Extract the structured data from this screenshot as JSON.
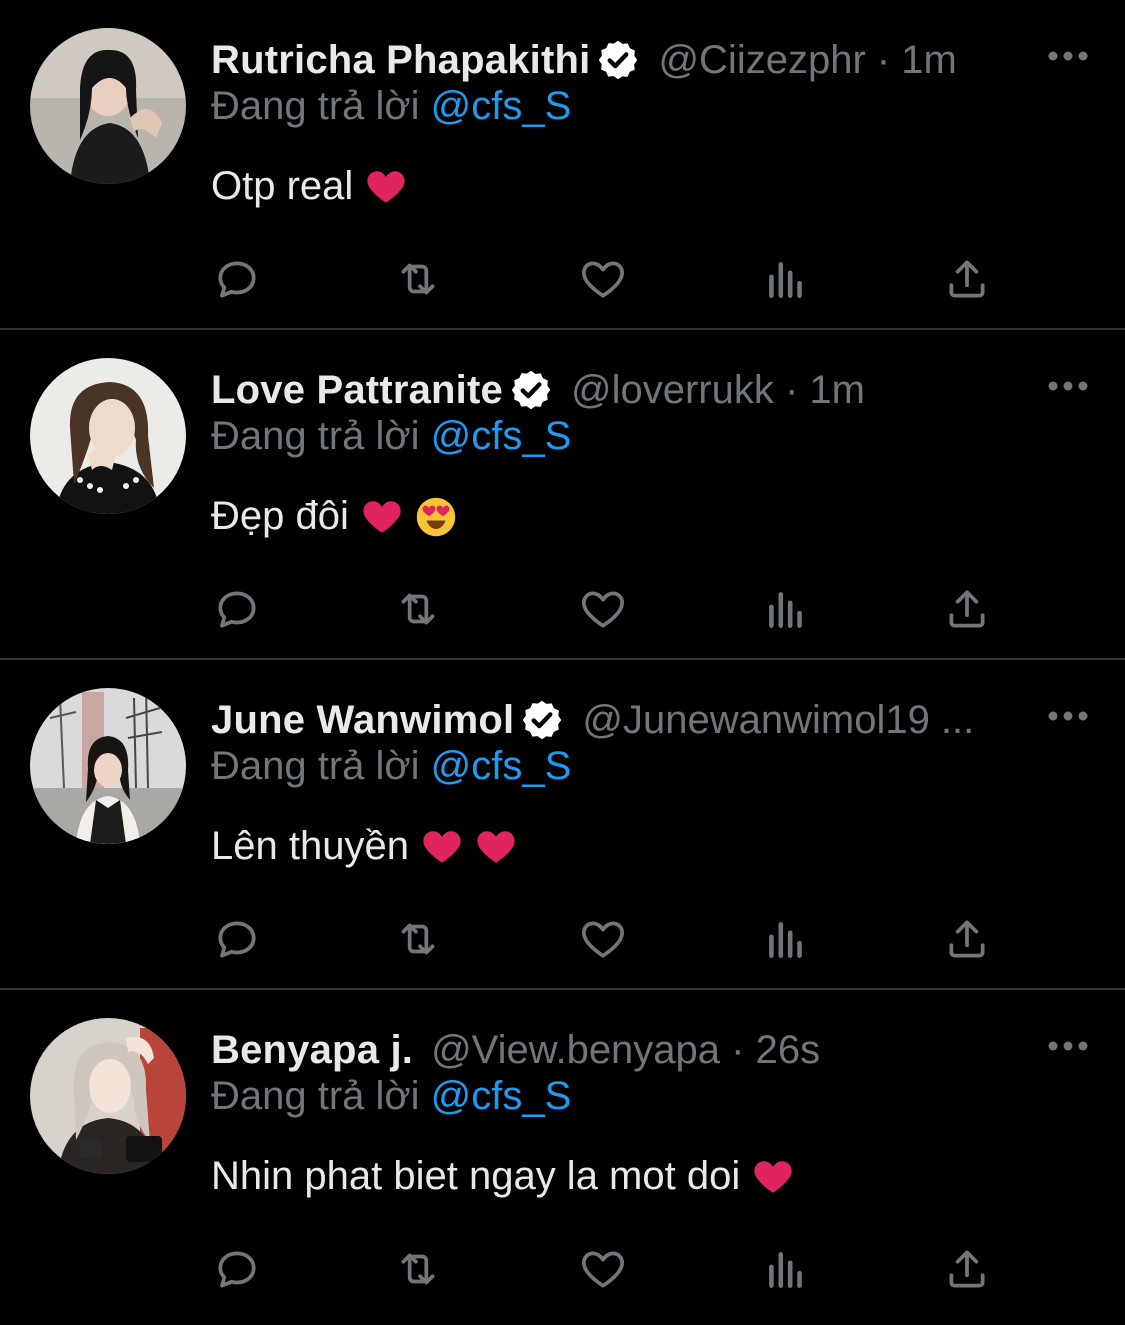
{
  "colors": {
    "background": "#000000",
    "primary_text": "#e7e9ea",
    "secondary_text": "#71767b",
    "link": "#1d9bf0",
    "divider": "#2f3336",
    "heart": "#e0245e"
  },
  "tweets": [
    {
      "name": "Rutricha Phapakithi",
      "verified": true,
      "meta": "@Ciizezphr · 1m",
      "reply_prefix": "Đang trả lời",
      "reply_handle": "@cfs_S",
      "text": "Otp real",
      "emojis": [
        "red-heart"
      ],
      "avatar": "woman-dark-hair-icon"
    },
    {
      "name": "Love Pattranite",
      "verified": true,
      "meta": "@loverrukk · 1m",
      "reply_prefix": "Đang trả lời",
      "reply_handle": "@cfs_S",
      "text": "Đẹp đôi",
      "emojis": [
        "red-heart",
        "heart-eyes-face"
      ],
      "avatar": "woman-long-hair-icon"
    },
    {
      "name": "June Wanwimol",
      "verified": true,
      "meta": "@Junewanwimol19 ...",
      "reply_prefix": "Đang trả lời",
      "reply_handle": "@cfs_S",
      "text": "Lên thuyền",
      "emojis": [
        "red-heart",
        "red-heart"
      ],
      "avatar": "woman-street-icon"
    },
    {
      "name": "Benyapa j.",
      "verified": false,
      "meta": "@View.benyapa · 26s",
      "reply_prefix": "Đang trả lời",
      "reply_handle": "@cfs_S",
      "text": "Nhin phat biet ngay la mot doi",
      "emojis": [
        "red-heart"
      ],
      "avatar": "woman-light-hair-icon"
    }
  ],
  "action_icons": [
    "reply-icon",
    "retweet-icon",
    "like-icon",
    "views-icon",
    "share-icon"
  ]
}
